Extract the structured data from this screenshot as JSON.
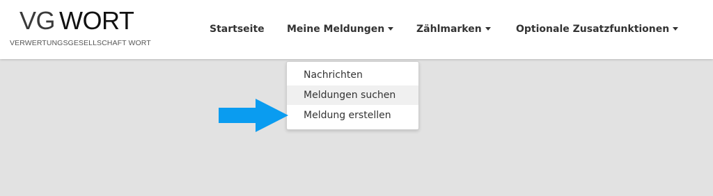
{
  "logo": {
    "vg": "VG",
    "wort": "WORT",
    "subtitle": "VERWERTUNGSGESELLSCHAFT WORT"
  },
  "nav": {
    "items": [
      {
        "label": "Startseite",
        "has_dropdown": false
      },
      {
        "label": "Meine Meldungen",
        "has_dropdown": true
      },
      {
        "label": "Zählmarken",
        "has_dropdown": true
      },
      {
        "label": "Optionale Zusatzfunktionen",
        "has_dropdown": true
      }
    ]
  },
  "dropdown": {
    "items": [
      {
        "label": "Nachrichten"
      },
      {
        "label": "Meldungen suchen"
      },
      {
        "label": "Meldung erstellen"
      }
    ]
  },
  "colors": {
    "header_bg": "#ffffff",
    "page_bg": "#e2e2e2",
    "arrow": "#0a9cf0",
    "text": "#333333"
  },
  "annotation": {
    "icon": "arrow-right-icon"
  }
}
